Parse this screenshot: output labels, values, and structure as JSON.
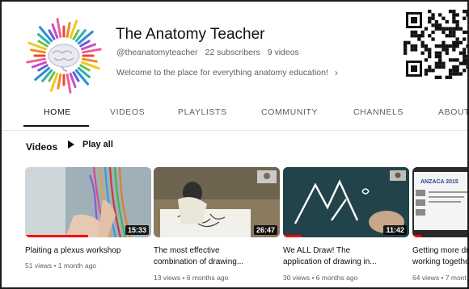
{
  "channel": {
    "name": "The Anatomy Teacher",
    "handle": "@theanatomyteacher",
    "subscribers": "22 subscribers",
    "video_count": "9 videos",
    "description": "Welcome to the place for everything anatomy education!",
    "description_chevron": "›"
  },
  "tabs": [
    {
      "label": "HOME",
      "active": true
    },
    {
      "label": "VIDEOS",
      "active": false
    },
    {
      "label": "PLAYLISTS",
      "active": false
    },
    {
      "label": "COMMUNITY",
      "active": false
    },
    {
      "label": "CHANNELS",
      "active": false
    },
    {
      "label": "ABOUT",
      "active": false
    }
  ],
  "section": {
    "title": "Videos",
    "play_all": "Play all"
  },
  "videos": [
    {
      "title_lines": [
        "Plaiting a plexus workshop"
      ],
      "duration": "15:33",
      "views": "51 views",
      "age": "1 month ago",
      "watched_fraction": 0.5
    },
    {
      "title_lines": [
        "The most effective",
        "combination of drawing..."
      ],
      "duration": "26:47",
      "views": "13 views",
      "age": "6 months ago",
      "watched_fraction": 0
    },
    {
      "title_lines": [
        "We ALL Draw! The",
        "application of drawing in..."
      ],
      "duration": "11:42",
      "views": "30 views",
      "age": "6 months ago",
      "watched_fraction": 0.15
    },
    {
      "title_lines": [
        "Getting more dr",
        "working togethe"
      ],
      "duration": "",
      "views": "64 views",
      "age": "7 mont",
      "slide_title": "ANZACA 2015",
      "watched_fraction": 0.15
    }
  ],
  "colors": {
    "progress": "#ff0000",
    "text_primary": "#0f0f0f",
    "text_secondary": "#606060"
  }
}
